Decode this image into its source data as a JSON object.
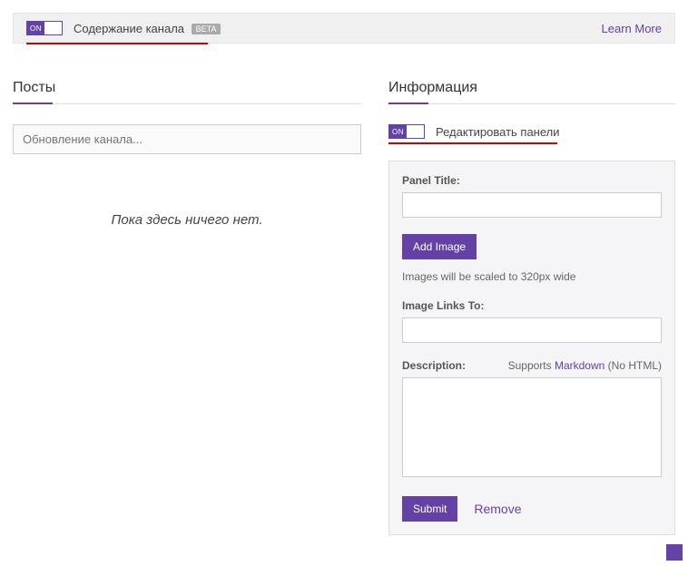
{
  "topBar": {
    "toggleOn": "ON",
    "label": "Содержание канала",
    "beta": "BETA",
    "learnMore": "Learn More"
  },
  "posts": {
    "heading": "Посты",
    "placeholder": "Обновление канала...",
    "empty": "Пока здесь ничего нет."
  },
  "info": {
    "heading": "Информация",
    "editToggleOn": "ON",
    "editLabel": "Редактировать панели"
  },
  "panelForm": {
    "titleLabel": "Panel Title:",
    "titleValue": "",
    "addImage": "Add Image",
    "imageHint": "Images will be scaled to 320px wide",
    "linkLabel": "Image Links To:",
    "linkValue": "",
    "descLabel": "Description:",
    "supportsPrefix": "Supports ",
    "markdown": "Markdown",
    "noHtml": " (No HTML)",
    "descValue": "",
    "submit": "Submit",
    "remove": "Remove"
  }
}
